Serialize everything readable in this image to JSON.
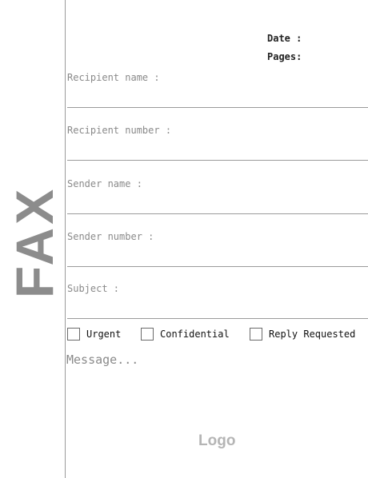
{
  "document": {
    "title": "FAX",
    "date_label": "Date :",
    "pages_label": "Pages:",
    "fields": [
      {
        "label": "Recipient name :"
      },
      {
        "label": "Recipient number :"
      },
      {
        "label": "Sender name :"
      },
      {
        "label": "Sender number :"
      },
      {
        "label": "Subject :"
      }
    ],
    "checkboxes": [
      {
        "label": "Urgent",
        "checked": false
      },
      {
        "label": "Confidential",
        "checked": false
      },
      {
        "label": "Reply Requested",
        "checked": false
      }
    ],
    "message_placeholder": "Message...",
    "logo_text": "Logo"
  }
}
